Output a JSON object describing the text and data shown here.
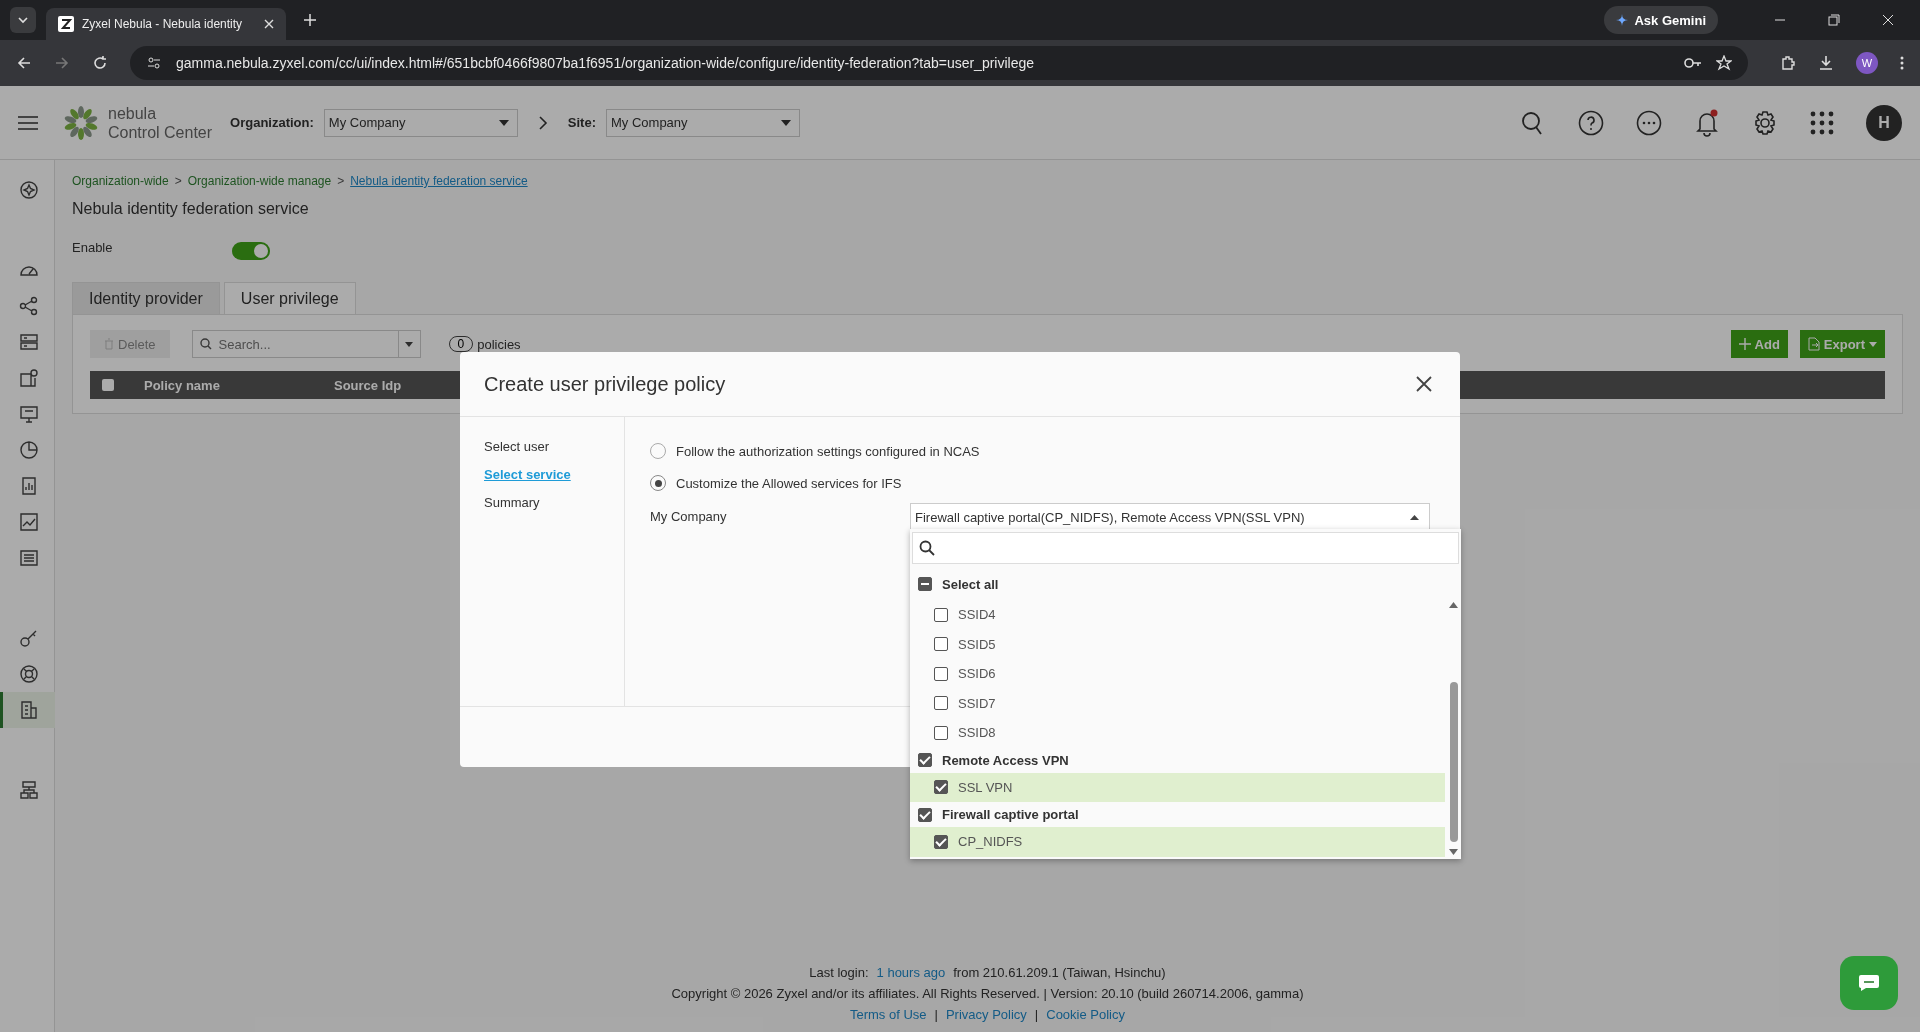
{
  "browser": {
    "tabs": [
      {
        "title": "Zyxel Nebula - Nebula identity",
        "selected": true
      }
    ],
    "url": "gamma.nebula.zyxel.com/cc/ui/index.html#/651bcbf0466f9807ba1f6951/organization-wide/configure/identity-federation?tab=user_privilege",
    "ask_gemini": "Ask Gemini",
    "profile": "W"
  },
  "header": {
    "logo_lines": [
      "nebula",
      "Control Center"
    ],
    "organization": {
      "label": "Organization:",
      "value": "My Company"
    },
    "site": {
      "label": "Site:",
      "value": "My Company"
    },
    "avatar": "H"
  },
  "sidebar": [
    {
      "selected": false
    },
    {
      "selected": false
    },
    {
      "selected": false
    },
    {
      "selected": false
    },
    {
      "selected": false
    },
    {
      "selected": false
    },
    {
      "selected": false
    },
    {
      "selected": false
    },
    {
      "selected": false
    },
    {
      "selected": false
    },
    {
      "selected": false
    },
    {
      "selected": false
    },
    {
      "selected": true
    },
    {
      "selected": false
    }
  ],
  "breadcrumb": {
    "items": [
      "Organization-wide",
      "Organization-wide manage",
      "Nebula identity federation service"
    ],
    "separators": [
      ">",
      ">"
    ]
  },
  "page_title": "Nebula identity federation service",
  "enable": {
    "label": "Enable",
    "on": true
  },
  "tabs": [
    {
      "label": "Identity provider",
      "selected": false
    },
    {
      "label": "User privilege",
      "selected": true
    }
  ],
  "toolbar": {
    "delete": "Delete",
    "search_placeholder": "Search...",
    "policy_count": "0",
    "policies_label": "policies",
    "add": "Add",
    "export": "Export"
  },
  "table": {
    "select_all_checked": false,
    "columns": [
      "Policy name",
      "Source Idp"
    ]
  },
  "modal": {
    "title": "Create user privilege policy",
    "steps": [
      {
        "label": "Select user",
        "selected": false
      },
      {
        "label": "Select service",
        "selected": true
      },
      {
        "label": "Summary",
        "selected": false
      }
    ],
    "options": [
      {
        "label": "Follow the authorization settings configured in NCAS",
        "selected": false
      },
      {
        "label": "Customize the Allowed services for IFS",
        "selected": true
      }
    ],
    "company_label": "My Company",
    "select_value": "Firewall captive portal(CP_NIDFS), Remote Access VPN(SSL VPN)",
    "dropdown": {
      "select_all": {
        "label": "Select all",
        "checked": false,
        "indeterminate": true
      },
      "items": [
        {
          "label": "SSID4",
          "kind": "option",
          "checked": false
        },
        {
          "label": "SSID5",
          "kind": "option",
          "checked": false
        },
        {
          "label": "SSID6",
          "kind": "option",
          "checked": false
        },
        {
          "label": "SSID7",
          "kind": "option",
          "checked": false
        },
        {
          "label": "SSID8",
          "kind": "option",
          "checked": false
        },
        {
          "label": "Remote Access VPN",
          "kind": "group",
          "checked": true
        },
        {
          "label": "SSL VPN",
          "kind": "option",
          "checked": true
        },
        {
          "label": "Firewall captive portal",
          "kind": "group",
          "checked": true
        },
        {
          "label": "CP_NIDFS",
          "kind": "option",
          "checked": true
        }
      ]
    }
  },
  "footer": {
    "last_login_label": "Last login:",
    "last_login_time": "1 hours ago",
    "last_login_from": "from 210.61.209.1 (Taiwan, Hsinchu)",
    "copyright": "Copyright © 2026 Zyxel and/or its affiliates. All Rights Reserved. | Version: 20.10 (build 260714.2006, gamma)",
    "links": [
      "Terms of Use",
      "Privacy Policy",
      "Cookie Policy"
    ],
    "link_separators": [
      "|",
      "|"
    ]
  }
}
